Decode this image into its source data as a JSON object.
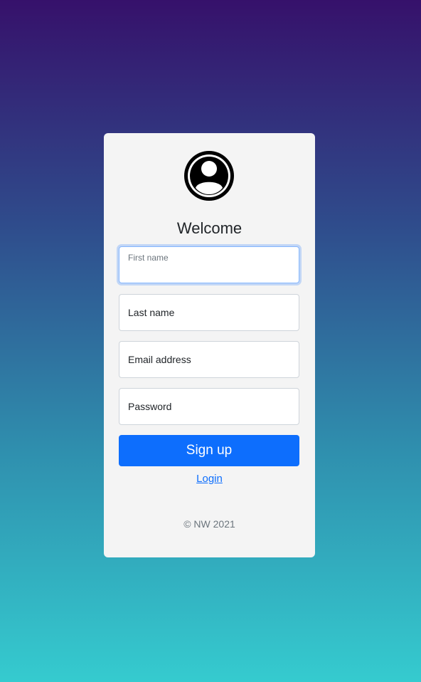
{
  "form": {
    "title": "Welcome",
    "fields": [
      {
        "label": "First name",
        "value": ""
      },
      {
        "label": "Last name",
        "value": ""
      },
      {
        "label": "Email address",
        "value": ""
      },
      {
        "label": "Password",
        "value": ""
      }
    ],
    "submit_label": "Sign up",
    "login_link": "Login",
    "footer": "© NW 2021"
  },
  "icons": {
    "avatar": "user-circle-icon"
  },
  "colors": {
    "primary": "#0d6efd",
    "card_bg": "#f4f4f4",
    "gradient_top": "#36116b",
    "gradient_bottom": "#35cbcf"
  }
}
